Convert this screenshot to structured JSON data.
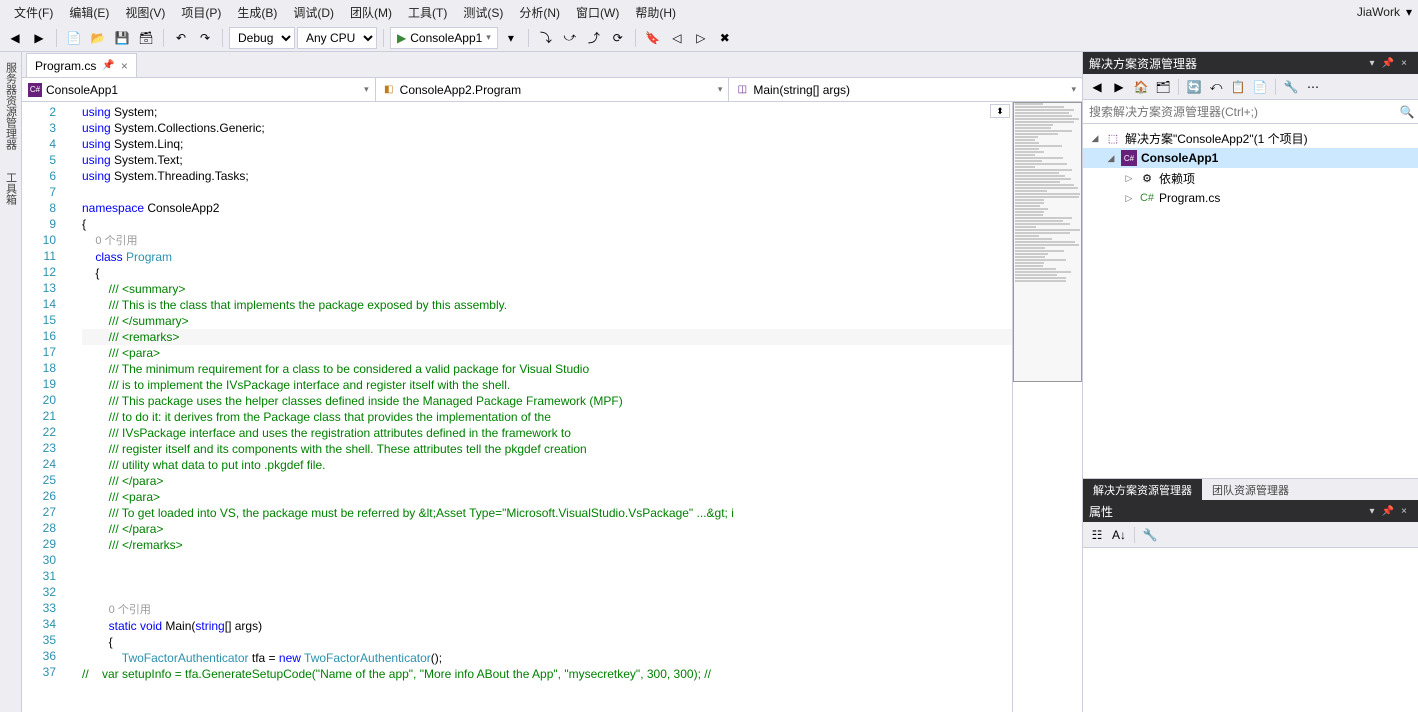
{
  "menu": {
    "items": [
      "文件(F)",
      "编辑(E)",
      "视图(V)",
      "项目(P)",
      "生成(B)",
      "调试(D)",
      "团队(M)",
      "工具(T)",
      "测试(S)",
      "分析(N)",
      "窗口(W)",
      "帮助(H)"
    ],
    "user": "JiaWork"
  },
  "toolbar": {
    "config": "Debug",
    "platform": "Any CPU",
    "start_label": "ConsoleApp1"
  },
  "tabs": {
    "active": "Program.cs"
  },
  "nav": {
    "project": "ConsoleApp1",
    "class": "ConsoleApp2.Program",
    "member": "Main(string[] args)"
  },
  "code": {
    "line_start": 2,
    "lines": [
      {
        "n": 2,
        "html": "<span class='kw'>using</span> System;"
      },
      {
        "n": 3,
        "html": "<span class='kw'>using</span> System.Collections.Generic;"
      },
      {
        "n": 4,
        "html": "<span class='kw'>using</span> System.Linq;"
      },
      {
        "n": 5,
        "html": "<span class='kw'>using</span> System.Text;"
      },
      {
        "n": 6,
        "html": "<span class='kw'>using</span> System.Threading.Tasks;"
      },
      {
        "n": 7,
        "html": ""
      },
      {
        "n": 8,
        "html": "<span class='kw'>namespace</span> ConsoleApp2"
      },
      {
        "n": 9,
        "html": "{"
      },
      {
        "n": null,
        "html": "    <span class='ref'>0 个引用</span>"
      },
      {
        "n": 10,
        "html": "    <span class='kw'>class</span> <span class='type'>Program</span>"
      },
      {
        "n": 11,
        "html": "    {"
      },
      {
        "n": 12,
        "html": "        <span class='cmt'>/// &lt;summary&gt;</span>"
      },
      {
        "n": 13,
        "html": "        <span class='cmt'>/// This is the class that implements the package exposed by this assembly.</span>"
      },
      {
        "n": 14,
        "html": "        <span class='cmt'>/// &lt;/summary&gt;</span>"
      },
      {
        "n": 15,
        "html": "        <span class='cmt'>/// &lt;remarks&gt;</span>",
        "current": true
      },
      {
        "n": 16,
        "html": "        <span class='cmt'>/// &lt;para&gt;</span>"
      },
      {
        "n": 17,
        "html": "        <span class='cmt'>/// The minimum requirement for a class to be considered a valid package for Visual Studio</span>"
      },
      {
        "n": 18,
        "html": "        <span class='cmt'>/// is to implement the IVsPackage interface and register itself with the shell.</span>"
      },
      {
        "n": 19,
        "html": "        <span class='cmt'>/// This package uses the helper classes defined inside the Managed Package Framework (MPF)</span>"
      },
      {
        "n": 20,
        "html": "        <span class='cmt'>/// to do it: it derives from the Package class that provides the implementation of the</span>"
      },
      {
        "n": 21,
        "html": "        <span class='cmt'>/// IVsPackage interface and uses the registration attributes defined in the framework to</span>"
      },
      {
        "n": 22,
        "html": "        <span class='cmt'>/// register itself and its components with the shell. These attributes tell the pkgdef creation</span>"
      },
      {
        "n": 23,
        "html": "        <span class='cmt'>/// utility what data to put into .pkgdef file.</span>"
      },
      {
        "n": 24,
        "html": "        <span class='cmt'>/// &lt;/para&gt;</span>"
      },
      {
        "n": 25,
        "html": "        <span class='cmt'>/// &lt;para&gt;</span>"
      },
      {
        "n": 26,
        "html": "        <span class='cmt'>/// To get loaded into VS, the package must be referred by &amp;lt;Asset Type=\"Microsoft.VisualStudio.VsPackage\" ...&amp;gt; i</span>"
      },
      {
        "n": 27,
        "html": "        <span class='cmt'>/// &lt;/para&gt;</span>"
      },
      {
        "n": 28,
        "html": "        <span class='cmt'>/// &lt;/remarks&gt;</span>"
      },
      {
        "n": 29,
        "html": ""
      },
      {
        "n": 30,
        "html": ""
      },
      {
        "n": 31,
        "html": ""
      },
      {
        "n": null,
        "html": "        <span class='ref'>0 个引用</span>"
      },
      {
        "n": 32,
        "html": "        <span class='kw'>static</span> <span class='kw'>void</span> Main(<span class='kw'>string</span>[] args)"
      },
      {
        "n": 33,
        "html": "        {"
      },
      {
        "n": 34,
        "html": "            <span class='type'>TwoFactorAuthenticator</span> tfa = <span class='kw'>new</span> <span class='type'>TwoFactorAuthenticator</span>();"
      },
      {
        "n": 35,
        "html": "<span class='cmt'>//    var setupInfo = tfa.GenerateSetupCode(\"Name of the app\", \"More info ABout the App\", \"mysecretkey\", 300, 300); //</span>"
      },
      {
        "n": 36,
        "html": ""
      },
      {
        "n": 37,
        "html": ""
      }
    ]
  },
  "solution_explorer": {
    "title": "解决方案资源管理器",
    "search_placeholder": "搜索解决方案资源管理器(Ctrl+;)",
    "solution": "解决方案\"ConsoleApp2\"(1 个项目)",
    "project": "ConsoleApp1",
    "deps": "依赖项",
    "file": "Program.cs",
    "tabs": [
      "解决方案资源管理器",
      "团队资源管理器"
    ]
  },
  "properties": {
    "title": "属性"
  },
  "left_tabs": [
    "服务器资源管理器",
    "工具箱"
  ]
}
